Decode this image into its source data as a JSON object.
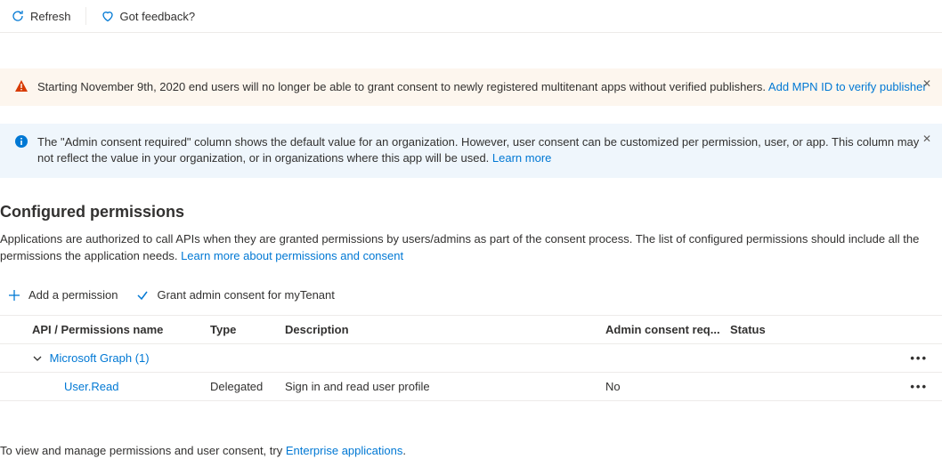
{
  "topbar": {
    "refresh_label": "Refresh",
    "feedback_label": "Got feedback?"
  },
  "banners": {
    "warning_text": "Starting November 9th, 2020 end users will no longer be able to grant consent to newly registered multitenant apps without verified publishers. ",
    "warning_link": "Add MPN ID to verify publisher",
    "info_text": "The \"Admin consent required\" column shows the default value for an organization. However, user consent can be customized per permission, user, or app. This column may not reflect the value in your organization, or in organizations where this app will be used. ",
    "info_link": "Learn more"
  },
  "section": {
    "title": "Configured permissions",
    "desc_text": "Applications are authorized to call APIs when they are granted permissions by users/admins as part of the consent process. The list of configured permissions should include all the permissions the application needs. ",
    "desc_link": "Learn more about permissions and consent"
  },
  "actions": {
    "add_permission": "Add a permission",
    "grant_consent": "Grant admin consent for myTenant"
  },
  "table": {
    "headers": {
      "name": "API / Permissions name",
      "type": "Type",
      "description": "Description",
      "admin_consent": "Admin consent req...",
      "status": "Status"
    },
    "group_label": "Microsoft Graph (1)",
    "rows": [
      {
        "name": "User.Read",
        "type": "Delegated",
        "description": "Sign in and read user profile",
        "admin_consent": "No",
        "status": ""
      }
    ]
  },
  "footer": {
    "text": "To view and manage permissions and user consent, try ",
    "link": "Enterprise applications",
    "period": "."
  }
}
